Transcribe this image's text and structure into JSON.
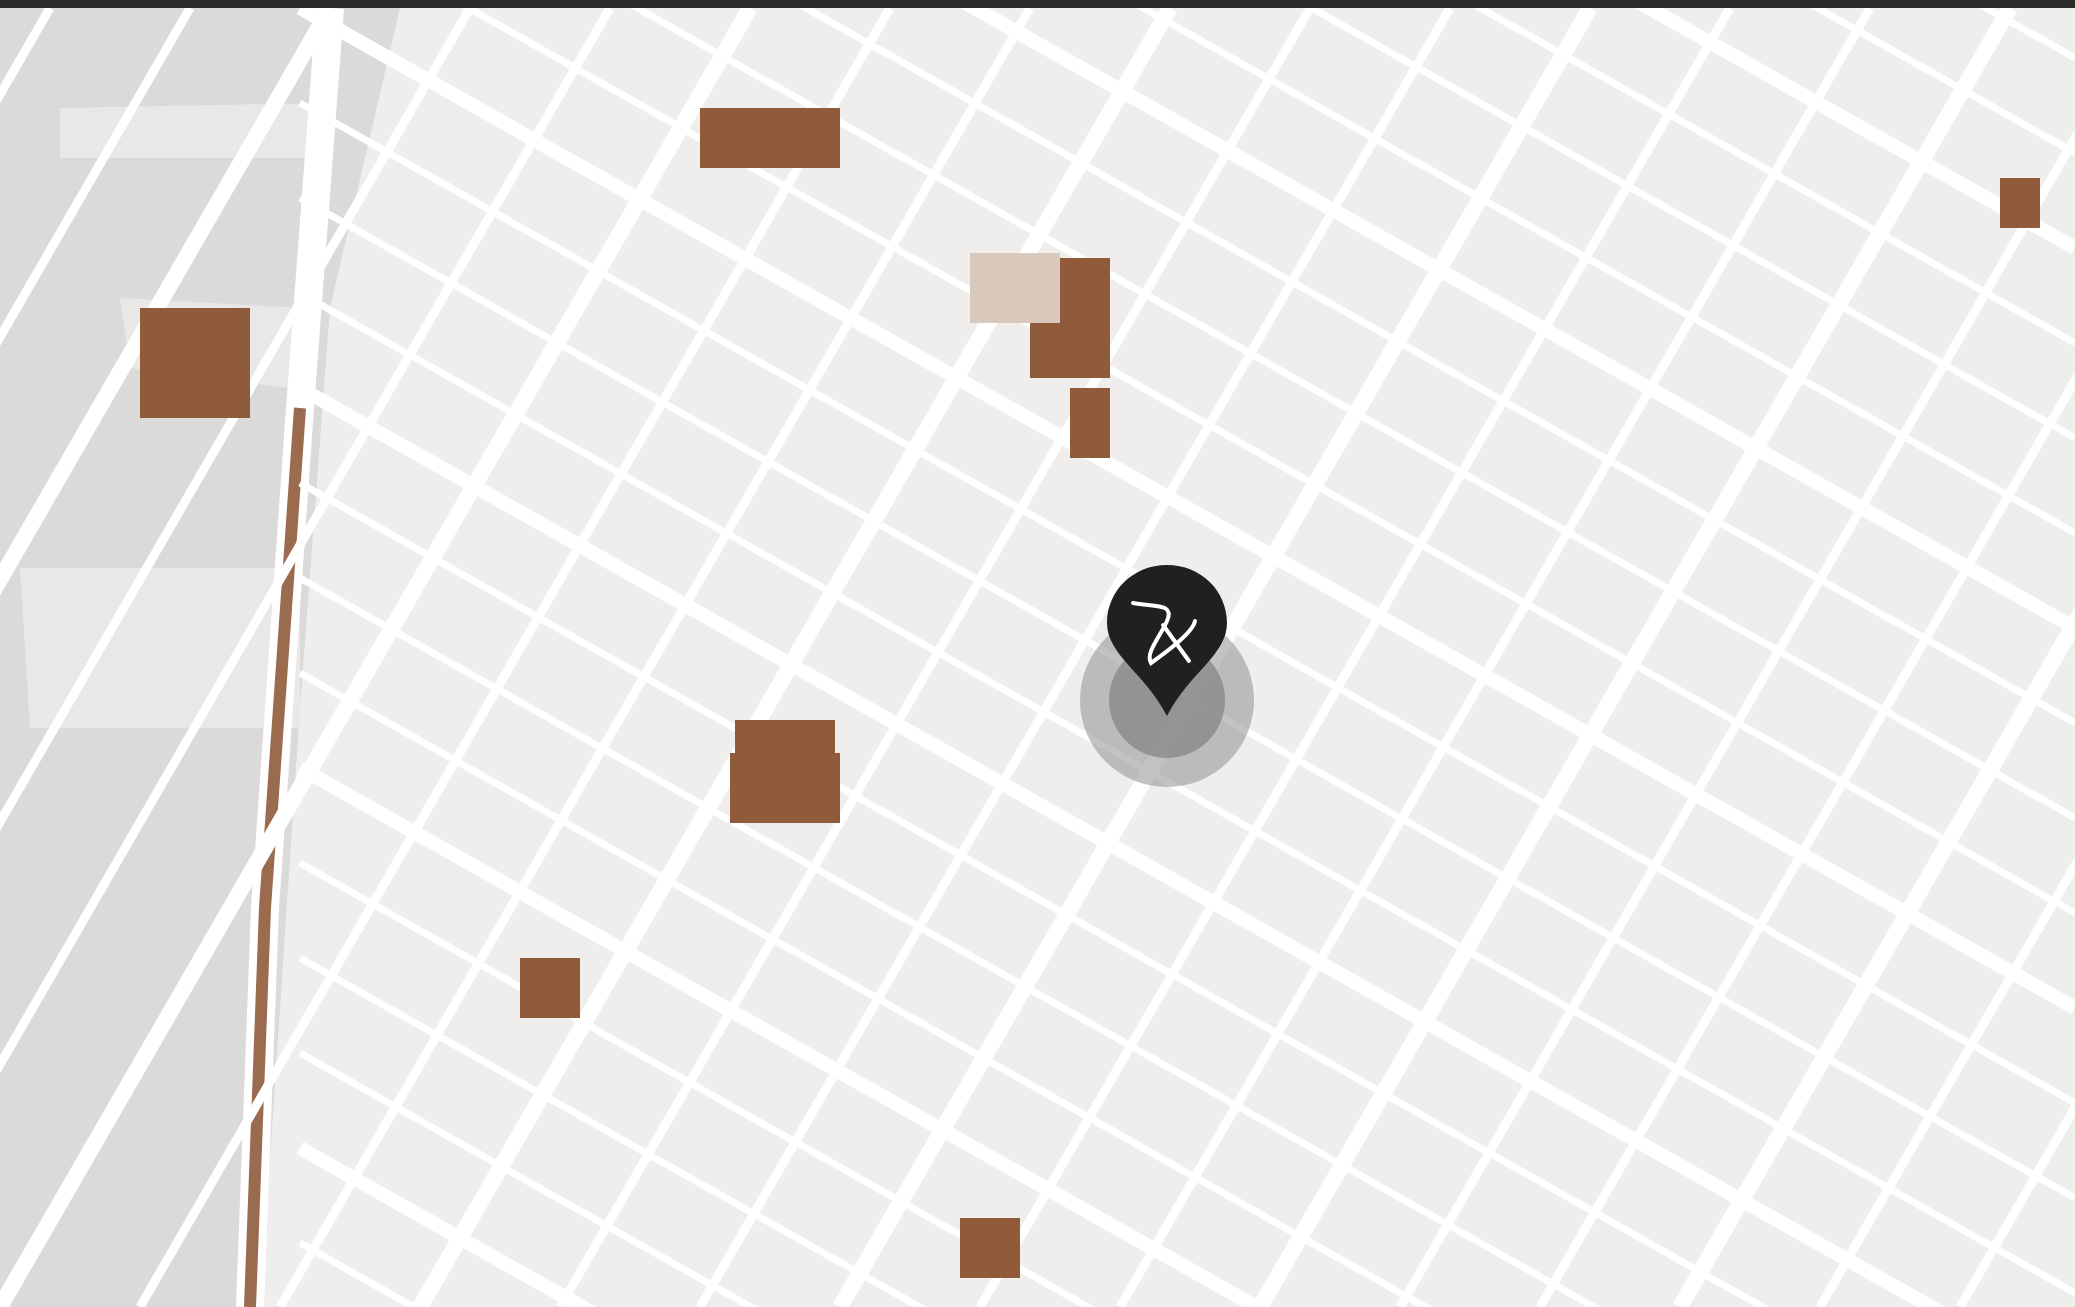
{
  "map": {
    "kind": "street-map"
  },
  "marker": {
    "kind": "logo-pin",
    "halo": true
  }
}
